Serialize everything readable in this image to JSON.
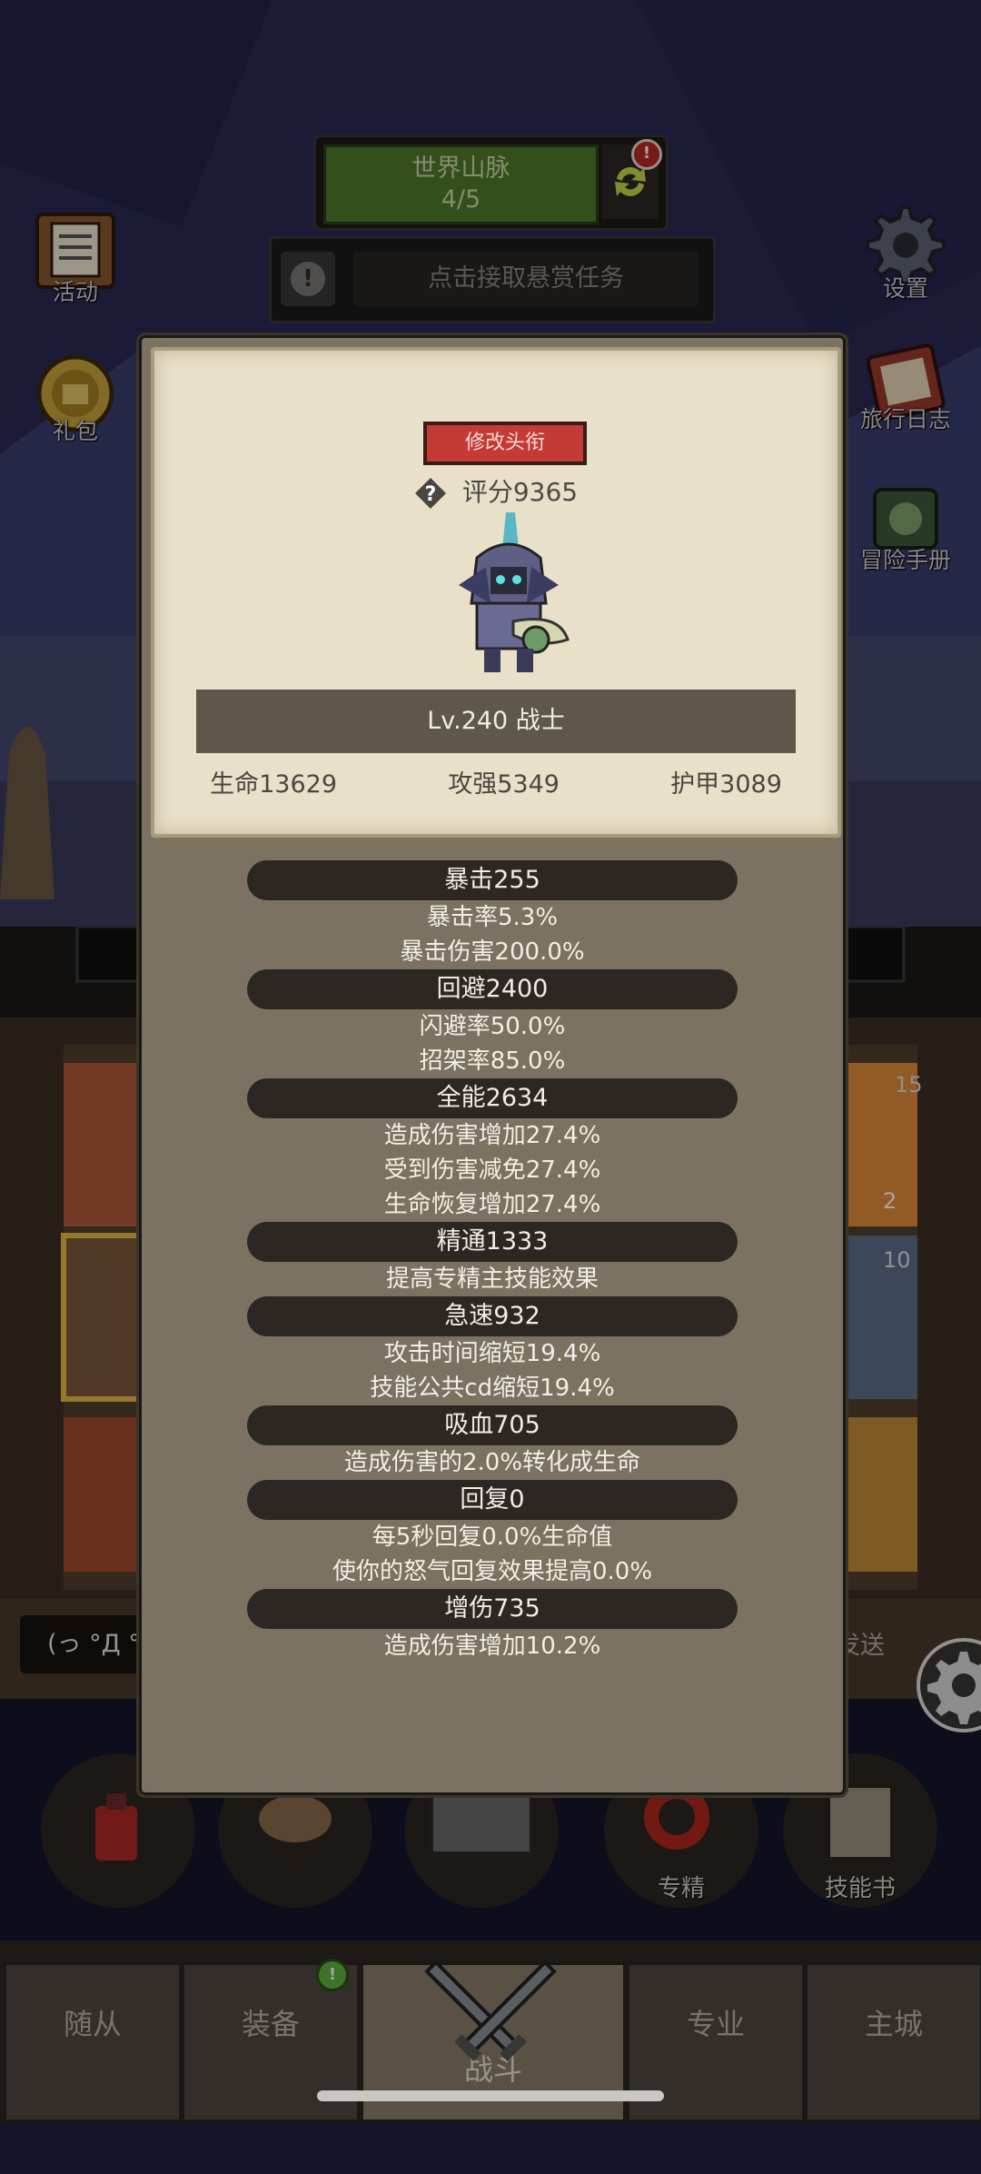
{
  "top": {
    "stage_name": "世界山脉",
    "stage_progress": "4/5",
    "bounty_text": "点击接取悬赏任务",
    "alert_badge": "!"
  },
  "left_menu": [
    {
      "label": "活动",
      "icon": "scroll-board-icon"
    },
    {
      "label": "礼包",
      "icon": "gift-coin-icon"
    }
  ],
  "right_menu": [
    {
      "label": "设置",
      "icon": "gear-icon"
    },
    {
      "label": "旅行日志",
      "icon": "journal-icon"
    },
    {
      "label": "冒险手册",
      "icon": "adventure-book-icon"
    }
  ],
  "profile": {
    "change_title_button": "修改头衔",
    "score": "评分9365",
    "level_class": "Lv.240 战士",
    "hp": "生命13629",
    "attack": "攻强5349",
    "armor": "护甲3089"
  },
  "attributes": [
    {
      "header": "暴击255",
      "lines": [
        "暴击率5.3%",
        "暴击伤害200.0%"
      ]
    },
    {
      "header": "回避2400",
      "lines": [
        "闪避率50.0%",
        "招架率85.0%"
      ]
    },
    {
      "header": "全能2634",
      "lines": [
        "造成伤害增加27.4%",
        "受到伤害减免27.4%",
        "生命恢复增加27.4%"
      ]
    },
    {
      "header": "精通1333",
      "lines": [
        "提高专精主技能效果"
      ]
    },
    {
      "header": "急速932",
      "lines": [
        "攻击时间缩短19.4%",
        "技能公共cd缩短19.4%"
      ]
    },
    {
      "header": "吸血705",
      "lines": [
        "造成伤害的2.0%转化成生命"
      ]
    },
    {
      "header": "回复0",
      "lines": [
        "每5秒回复0.0%生命值",
        "使你的怒气回复效果提高0.0%"
      ]
    },
    {
      "header": "增伤735",
      "lines": [
        "造成伤害增加10.2%"
      ]
    }
  ],
  "chat": {
    "input_text": "(っ °Д °",
    "send_label": "发送"
  },
  "skills": [
    {
      "label": "",
      "icon": "potion-icon"
    },
    {
      "label": "",
      "icon": "bread-icon"
    },
    {
      "label": "",
      "icon": "chest-icon"
    },
    {
      "label": "专精",
      "icon": "specialization-icon"
    },
    {
      "label": "技能书",
      "icon": "skill-book-icon"
    }
  ],
  "nav": {
    "tabs": [
      "随从",
      "装备",
      "战斗",
      "专业",
      "主城"
    ],
    "active": "战斗",
    "equip_badge": "!"
  },
  "colors": {
    "modal_bg": "#7b7262",
    "parchment": "#e9e0c9",
    "title_button": "#c43a35",
    "stage_green": "#4f7a2a"
  }
}
